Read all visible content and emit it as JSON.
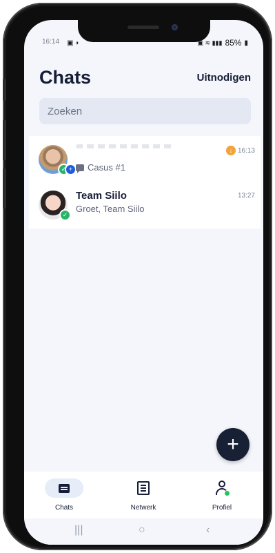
{
  "status_bar": {
    "time": "16:14",
    "battery": "85%"
  },
  "header": {
    "title": "Chats",
    "invite_label": "Uitnodigen"
  },
  "search": {
    "placeholder": "Zoeken"
  },
  "chats": [
    {
      "name": "",
      "preview": "Casus #1",
      "time": "16:13",
      "status_badge": "plus-icon"
    },
    {
      "name": "Team Siilo",
      "preview": "Groet, Team Siilo",
      "time": "13:27",
      "status_badge": "check-icon"
    }
  ],
  "fab": {
    "icon": "plus-icon"
  },
  "bottom_nav": [
    {
      "label": "Chats",
      "icon": "chat-icon",
      "active": true
    },
    {
      "label": "Netwerk",
      "icon": "newspaper-icon",
      "active": false
    },
    {
      "label": "Profiel",
      "icon": "user-icon",
      "active": false
    }
  ],
  "colors": {
    "navy": "#161d36",
    "background": "#f4f6fb",
    "accent_green": "#22c55e",
    "accent_orange": "#f2a33a"
  }
}
